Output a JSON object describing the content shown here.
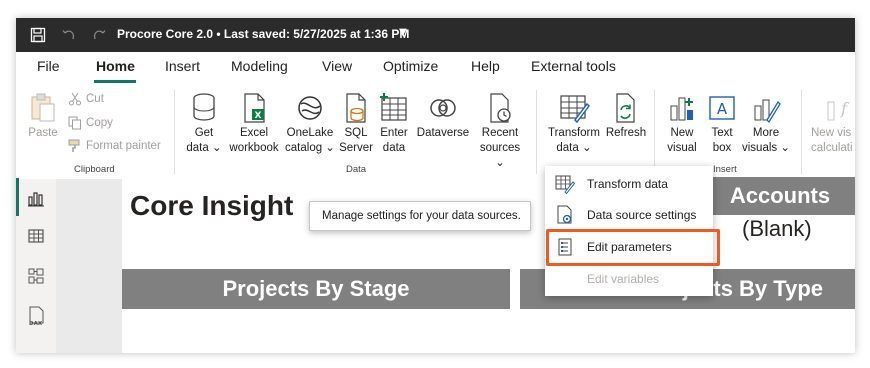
{
  "titlebar": {
    "title": "Procore Core 2.0 • Last saved: 5/27/2025 at 1:36 PM"
  },
  "menu": [
    "File",
    "Home",
    "Insert",
    "Modeling",
    "View",
    "Optimize",
    "Help",
    "External tools"
  ],
  "ribbon": {
    "clipboard": {
      "paste": "Paste",
      "cut": "Cut",
      "copy": "Copy",
      "format_painter": "Format painter",
      "label": "Clipboard"
    },
    "data": {
      "get_data": [
        "Get",
        "data ⌄"
      ],
      "excel": [
        "Excel",
        "workbook"
      ],
      "onelake": [
        "OneLake",
        "catalog ⌄"
      ],
      "sql": [
        "SQL",
        "Server"
      ],
      "enter": [
        "Enter",
        "data"
      ],
      "dataverse": "Dataverse",
      "recent": [
        "Recent",
        "sources ⌄"
      ],
      "label": "Data"
    },
    "queries": {
      "transform": [
        "Transform",
        "data ⌄"
      ],
      "refresh": "Refresh"
    },
    "insert": {
      "new_visual": [
        "New",
        "visual"
      ],
      "text_box": [
        "Text",
        "box"
      ],
      "more_visuals": [
        "More",
        "visuals ⌄"
      ],
      "label": "Insert"
    },
    "calc": {
      "new_visual_calc": [
        "New vis",
        "calculati"
      ]
    }
  },
  "report": {
    "title": "Core Insight",
    "accounts_header": "Accounts",
    "accounts_value": "(Blank)",
    "projects_by_stage": "Projects By Stage",
    "projects_by_type": "Projects By Type"
  },
  "tooltip": "Manage settings for your data sources.",
  "dropdown": {
    "items": [
      "Transform data",
      "Data source settings",
      "Edit parameters",
      "Edit variables"
    ]
  },
  "colors": {
    "accent": "#117865",
    "highlight": "#f05a22",
    "header_bar": "#808080",
    "titlebar": "#2b2b2b"
  }
}
